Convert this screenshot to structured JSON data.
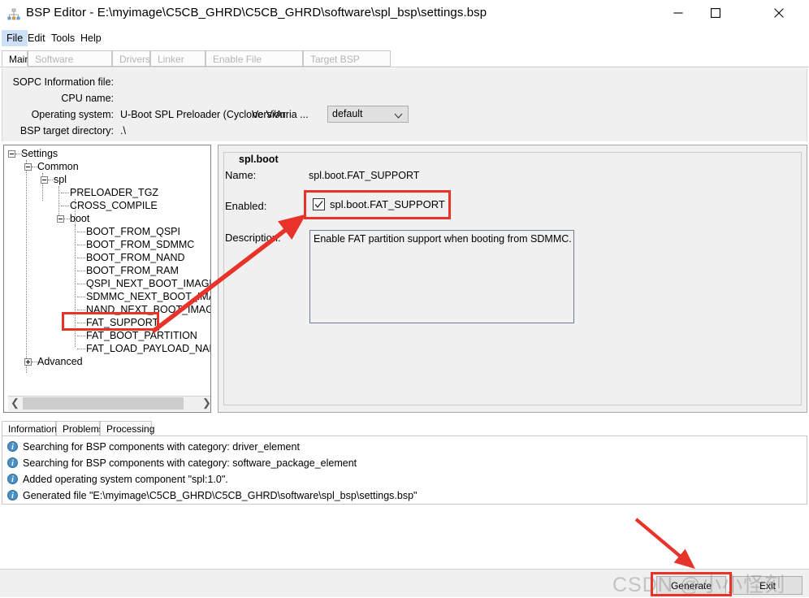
{
  "window": {
    "title": "BSP Editor - E:\\myimage\\C5CB_GHRD\\C5CB_GHRD\\software\\spl_bsp\\settings.bsp",
    "icon": "bsp-editor-icon",
    "controls": {
      "minimize": "minimize-icon",
      "maximize": "maximize-icon",
      "close": "close-icon"
    }
  },
  "menubar": {
    "items": [
      {
        "label": "File",
        "selected": true
      },
      {
        "label": "Edit",
        "selected": false
      },
      {
        "label": "Tools",
        "selected": false
      },
      {
        "label": "Help",
        "selected": false
      }
    ]
  },
  "tabs": [
    {
      "label": "Main",
      "active": true,
      "enabled": true
    },
    {
      "label": "Software Packages",
      "active": false,
      "enabled": false
    },
    {
      "label": "Drivers",
      "active": false,
      "enabled": false
    },
    {
      "label": "Linker Script",
      "active": false,
      "enabled": false
    },
    {
      "label": "Enable File Generation",
      "active": false,
      "enabled": false
    },
    {
      "label": "Target BSP Directory",
      "active": false,
      "enabled": false
    }
  ],
  "form": {
    "sopc_label": "SOPC Information file:",
    "sopc_value": "",
    "cpu_label": "CPU name:",
    "cpu_value": "",
    "os_label": "Operating system:",
    "os_value": "U-Boot SPL Preloader (Cyclone V/Arria ...",
    "version_label": "Version:",
    "version_value": "default",
    "bsp_dir_label": "BSP target directory:",
    "bsp_dir_value": ".\\"
  },
  "tree": {
    "nodes": [
      {
        "label": "Settings",
        "depth": 0,
        "toggle": "minus"
      },
      {
        "label": "Common",
        "depth": 1,
        "toggle": "minus"
      },
      {
        "label": "spl",
        "depth": 2,
        "toggle": "minus"
      },
      {
        "label": "PRELOADER_TGZ",
        "depth": 3,
        "toggle": "none"
      },
      {
        "label": "CROSS_COMPILE",
        "depth": 3,
        "toggle": "none"
      },
      {
        "label": "boot",
        "depth": 3,
        "toggle": "minus"
      },
      {
        "label": "BOOT_FROM_QSPI",
        "depth": 4,
        "toggle": "none"
      },
      {
        "label": "BOOT_FROM_SDMMC",
        "depth": 4,
        "toggle": "none"
      },
      {
        "label": "BOOT_FROM_NAND",
        "depth": 4,
        "toggle": "none"
      },
      {
        "label": "BOOT_FROM_RAM",
        "depth": 4,
        "toggle": "none"
      },
      {
        "label": "QSPI_NEXT_BOOT_IMAGE",
        "depth": 4,
        "toggle": "none"
      },
      {
        "label": "SDMMC_NEXT_BOOT_IMAGE",
        "depth": 4,
        "toggle": "none"
      },
      {
        "label": "NAND_NEXT_BOOT_IMAGE",
        "depth": 4,
        "toggle": "none"
      },
      {
        "label": "FAT_SUPPORT",
        "depth": 4,
        "toggle": "none"
      },
      {
        "label": "FAT_BOOT_PARTITION",
        "depth": 4,
        "toggle": "none"
      },
      {
        "label": "FAT_LOAD_PAYLOAD_NAME",
        "depth": 4,
        "toggle": "none"
      },
      {
        "label": "Advanced",
        "depth": 1,
        "toggle": "plus"
      }
    ],
    "scrollbar": {
      "left_arrow": "❮",
      "right_arrow": "❯"
    }
  },
  "detail": {
    "group_title": "spl.boot",
    "name_label": "Name:",
    "name_value": "spl.boot.FAT_SUPPORT",
    "enabled_label": "Enabled:",
    "enabled_checkbox_label": "spl.boot.FAT_SUPPORT",
    "enabled_checked": true,
    "description_label": "Description:",
    "description_value": "Enable FAT partition support when booting from SDMMC."
  },
  "log": {
    "tabs": [
      {
        "label": "Information",
        "active": true
      },
      {
        "label": "Problems",
        "active": false
      },
      {
        "label": "Processing",
        "active": false
      }
    ],
    "entries": [
      {
        "icon": "info-icon",
        "text": "Searching for BSP components with category: driver_element"
      },
      {
        "icon": "info-icon",
        "text": "Searching for BSP components with category: software_package_element"
      },
      {
        "icon": "info-icon",
        "text": "Added operating system component \"spl:1.0\"."
      },
      {
        "icon": "info-icon",
        "text": "Generated file \"E:\\myimage\\C5CB_GHRD\\C5CB_GHRD\\software\\spl_bsp\\settings.bsp\""
      }
    ]
  },
  "buttons": {
    "generate": "Generate",
    "exit": "Exit"
  },
  "annotations": {
    "highlight_color": "#e8332a",
    "arrow_color": "#e8332a",
    "boxes": [
      "tree-fat-support",
      "enabled-checkbox",
      "generate-button"
    ],
    "arrows": [
      "tree-to-checkbox",
      "pointer-to-generate"
    ]
  },
  "watermark": {
    "text": "CSDN @小小怪刻"
  }
}
